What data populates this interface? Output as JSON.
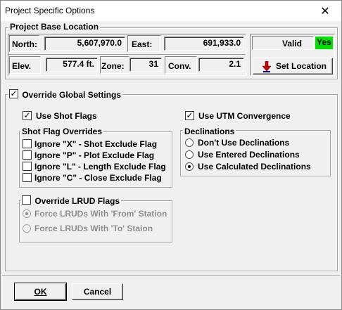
{
  "window": {
    "title": "Project Specific Options",
    "close_glyph": "✕"
  },
  "base_location": {
    "legend": "Project Base Location",
    "north_label": "North:",
    "north_value": "5,607,970.0",
    "east_label": "East:",
    "east_value": "691,933.0",
    "elev_label": "Elev.",
    "elev_value": "577.4 ft.",
    "zone_label": "Zone:",
    "zone_value": "31",
    "conv_label": "Conv.",
    "conv_value": "2.1",
    "valid_label": "Valid",
    "valid_value": "Yes",
    "set_location_label": "Set Location",
    "set_location_icon": "red-down-arrow-icon",
    "valid_color": "#00e000"
  },
  "override": {
    "label": "Override Global Settings",
    "checked": true,
    "use_shot_flags_label": "Use Shot Flags",
    "use_shot_flags_checked": true,
    "use_utm_label": "Use UTM Convergence",
    "use_utm_checked": true
  },
  "shot_flag_overrides": {
    "legend": "Shot Flag Overrides",
    "items": [
      {
        "label": "Ignore \"X\" - Shot Exclude Flag",
        "checked": false
      },
      {
        "label": "Ignore \"P\" - Plot Exclude Flag",
        "checked": false
      },
      {
        "label": "Ignore \"L\" - Length Exclude Flag",
        "checked": false
      },
      {
        "label": "Ignore \"C\" - Close Exclude Flag",
        "checked": false
      }
    ]
  },
  "declinations": {
    "legend": "Declinations",
    "options": [
      {
        "label": "Don't Use Declinations",
        "selected": false
      },
      {
        "label": "Use Entered Declinations",
        "selected": false
      },
      {
        "label": "Use Calculated Declinations",
        "selected": true
      }
    ]
  },
  "lrud": {
    "label": "Override LRUD Flags",
    "checked": false,
    "options": [
      {
        "label": "Force LRUDs With 'From' Station",
        "selected": true
      },
      {
        "label": "Force LRUDs With 'To' Staion",
        "selected": false
      }
    ]
  },
  "buttons": {
    "ok": "OK",
    "cancel": "Cancel"
  }
}
